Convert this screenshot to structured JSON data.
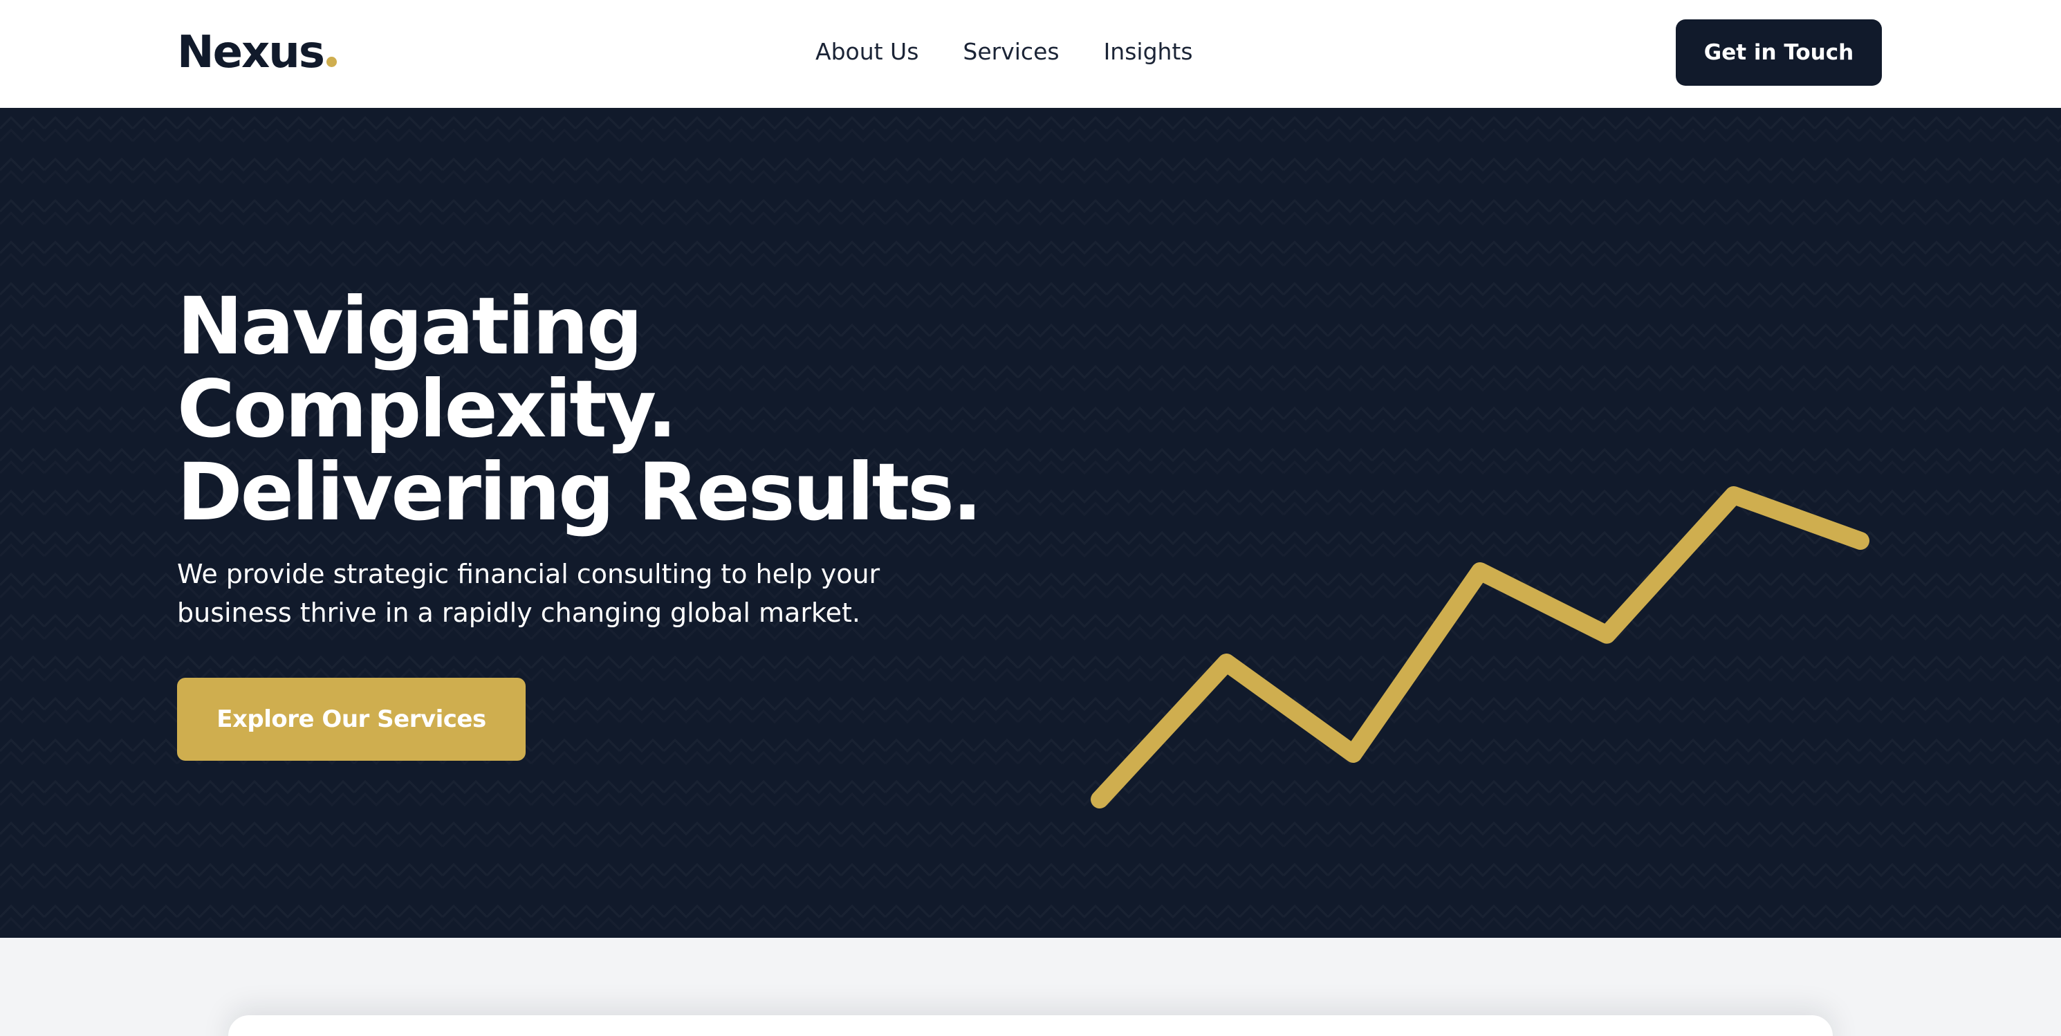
{
  "brand": {
    "name": "Nexus",
    "accent_color": "#cfae4f",
    "navy_color": "#111a2b"
  },
  "nav": {
    "links": [
      "About Us",
      "Services",
      "Insights"
    ],
    "cta_label": "Get in Touch"
  },
  "hero": {
    "title_lines": [
      "Navigating",
      "Complexity.",
      "Delivering Results."
    ],
    "subtitle": "We provide strategic financial consulting to help your business thrive in a rapidly changing global market.",
    "cta_label": "Explore Our Services",
    "background_color": "#111a2b",
    "illustration": {
      "icon": "trend-line-icon",
      "trend_values": [
        0,
        0.54,
        0.18,
        0.9,
        0.65,
        1.2,
        1.02
      ]
    }
  }
}
